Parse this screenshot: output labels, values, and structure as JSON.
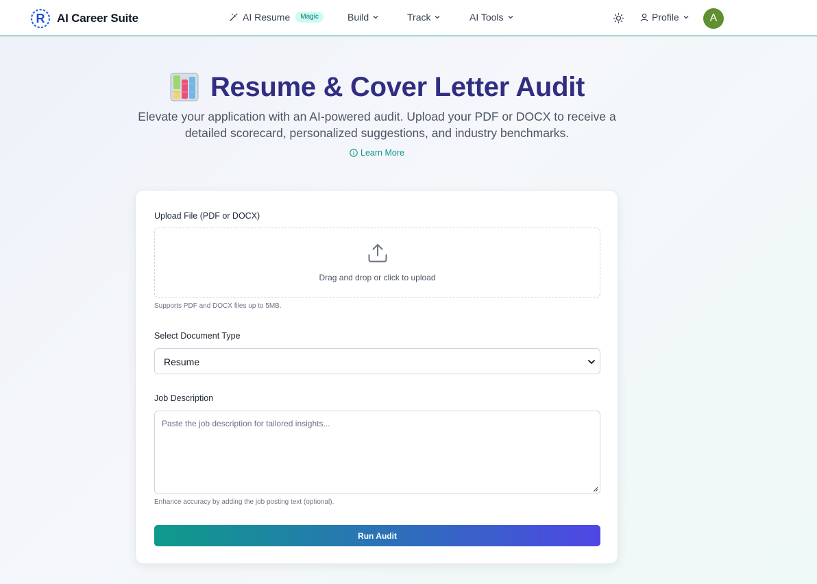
{
  "nav": {
    "brand": "AI Career Suite",
    "ai_resume": "AI Resume",
    "ai_resume_badge": "Magic",
    "build": "Build",
    "track": "Track",
    "ai_tools": "AI Tools",
    "profile": "Profile",
    "avatar_initial": "A"
  },
  "hero": {
    "title": "Resume & Cover Letter Audit",
    "subtitle": "Elevate your application with an AI-powered audit. Upload your PDF or DOCX to receive a detailed scorecard, personalized suggestions, and industry benchmarks.",
    "learn_more": "Learn More"
  },
  "form": {
    "upload_label": "Upload File (PDF or DOCX)",
    "upload_text": "Drag and drop or click to upload",
    "upload_hint": "Supports PDF and DOCX files up to 5MB.",
    "doc_type_label": "Select Document Type",
    "doc_type_value": "Resume",
    "job_label": "Job Description",
    "job_placeholder": "Paste the job description for tailored insights...",
    "job_hint": "Enhance accuracy by adding the job posting text (optional).",
    "run_button": "Run Audit"
  },
  "icons": {
    "logo": "r-logo-icon",
    "ai_resume": "magic-wand-icon",
    "theme": "sun-icon",
    "profile": "user-icon",
    "hero": "bar-chart-icon",
    "learn_more": "info-icon",
    "upload": "upload-icon"
  },
  "colors": {
    "accent": "#0d9488",
    "title": "#312e81",
    "avatar": "#5f8f2e",
    "badge_bg": "#ccfbf1",
    "button_start": "#0e9b8a",
    "button_end": "#4f46e5"
  }
}
